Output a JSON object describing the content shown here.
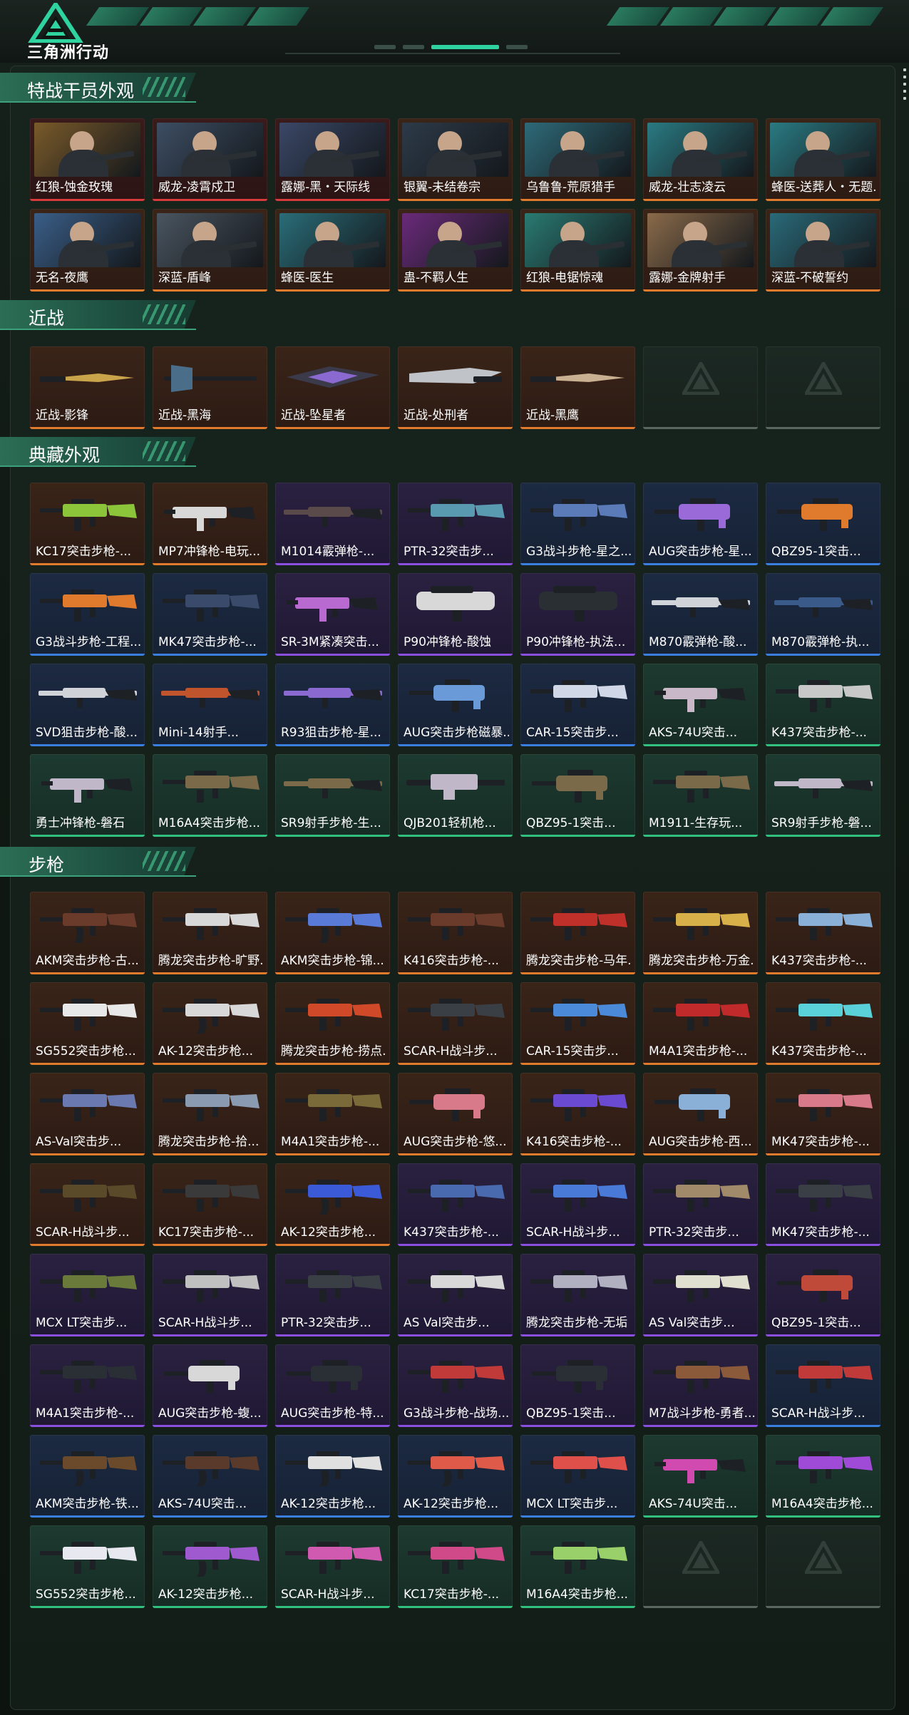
{
  "app": {
    "logo_text": "三角洲行动"
  },
  "sections": [
    {
      "title": "特战干员外观",
      "items": [
        {
          "label": "红狼-蚀金玫瑰",
          "rarity": "red",
          "kind": "agent",
          "tint": "#7a5a2a"
        },
        {
          "label": "威龙-凌霄戍卫",
          "rarity": "red",
          "kind": "agent",
          "tint": "#3d4e63"
        },
        {
          "label": "露娜-黑・天际线",
          "rarity": "red",
          "kind": "agent",
          "tint": "#3a4766"
        },
        {
          "label": "银翼-未结卷宗",
          "rarity": "orange",
          "kind": "agent",
          "tint": "#2d3a48"
        },
        {
          "label": "乌鲁鲁-荒原猎手",
          "rarity": "orange",
          "kind": "agent",
          "tint": "#2e6a78"
        },
        {
          "label": "威龙-壮志凌云",
          "rarity": "orange",
          "kind": "agent",
          "tint": "#2a7a82"
        },
        {
          "label": "蜂医-送葬人・无题...",
          "rarity": "orange",
          "kind": "agent",
          "tint": "#2a7a82"
        },
        {
          "label": "无名-夜鹰",
          "rarity": "orange",
          "kind": "agent",
          "tint": "#3a5e88"
        },
        {
          "label": "深蓝-盾峰",
          "rarity": "orange",
          "kind": "agent",
          "tint": "#4a5560"
        },
        {
          "label": "蜂医-医生",
          "rarity": "orange",
          "kind": "agent",
          "tint": "#2a6d78"
        },
        {
          "label": "蛊-不羁人生",
          "rarity": "orange",
          "kind": "agent",
          "tint": "#6a2a7a"
        },
        {
          "label": "红狼-电锯惊魂",
          "rarity": "orange",
          "kind": "agent",
          "tint": "#2a7a72"
        },
        {
          "label": "露娜-金牌射手",
          "rarity": "orange",
          "kind": "agent",
          "tint": "#8a6a4a"
        },
        {
          "label": "深蓝-不破誓约",
          "rarity": "orange",
          "kind": "agent",
          "tint": "#2a6a78"
        }
      ]
    },
    {
      "title": "近战",
      "items": [
        {
          "label": "近战-影锋",
          "rarity": "orange",
          "kind": "knife",
          "tint": "#c9a44a"
        },
        {
          "label": "近战-黑海",
          "rarity": "orange",
          "kind": "axe",
          "tint": "#4a6d8a"
        },
        {
          "label": "近战-坠星者",
          "rarity": "orange",
          "kind": "star",
          "tint": "#8a6ad0"
        },
        {
          "label": "近战-处刑者",
          "rarity": "orange",
          "kind": "blade",
          "tint": "#c0c4c8"
        },
        {
          "label": "近战-黑鹰",
          "rarity": "orange",
          "kind": "knife2",
          "tint": "#c8b090"
        },
        {
          "label": "",
          "rarity": "empty",
          "kind": "empty"
        },
        {
          "label": "",
          "rarity": "empty",
          "kind": "empty"
        }
      ]
    },
    {
      "title": "典藏外观",
      "items": [
        {
          "label": "KC17突击步枪-...",
          "rarity": "orange",
          "kind": "rifle",
          "tint": "#8cc43a"
        },
        {
          "label": "MP7冲锋枪-电玩...",
          "rarity": "orange",
          "kind": "smg",
          "tint": "#d8d8d8"
        },
        {
          "label": "M1014霰弹枪-...",
          "rarity": "purple",
          "kind": "shotgun",
          "tint": "#5a4a4a"
        },
        {
          "label": "PTR-32突击步...",
          "rarity": "purple",
          "kind": "rifle",
          "tint": "#5a9ab0"
        },
        {
          "label": "G3战斗步枪-星之...",
          "rarity": "blue",
          "kind": "rifle",
          "tint": "#5a7ab8"
        },
        {
          "label": "AUG突击步枪-星...",
          "rarity": "blue",
          "kind": "bullpup",
          "tint": "#9a6ad8"
        },
        {
          "label": "QBZ95-1突击...",
          "rarity": "blue",
          "kind": "bullpup",
          "tint": "#e07a2c"
        },
        {
          "label": "G3战斗步枪-工程...",
          "rarity": "blue",
          "kind": "rifle",
          "tint": "#e07a2c"
        },
        {
          "label": "MK47突击步枪-...",
          "rarity": "blue",
          "kind": "rifle",
          "tint": "#3a4a6a"
        },
        {
          "label": "SR-3M紧凑突击...",
          "rarity": "purple",
          "kind": "smg",
          "tint": "#b86ad0"
        },
        {
          "label": "P90冲锋枪-酸蚀",
          "rarity": "purple",
          "kind": "p90",
          "tint": "#d8d8d8"
        },
        {
          "label": "P90冲锋枪-执法...",
          "rarity": "purple",
          "kind": "p90",
          "tint": "#2a2f33"
        },
        {
          "label": "M870霰弹枪-酸...",
          "rarity": "blue",
          "kind": "shotgun",
          "tint": "#d0d4d8"
        },
        {
          "label": "M870霰弹枪-执...",
          "rarity": "blue",
          "kind": "shotgun",
          "tint": "#3a5a8a"
        },
        {
          "label": "SVD狙击步枪-酸...",
          "rarity": "blue",
          "kind": "sniper",
          "tint": "#d0d4d8"
        },
        {
          "label": "Mini-14射手...",
          "rarity": "blue",
          "kind": "sniper",
          "tint": "#c0542c"
        },
        {
          "label": "R93狙击步枪-星...",
          "rarity": "blue",
          "kind": "sniper",
          "tint": "#8a6ad0"
        },
        {
          "label": "AUG突击步枪磁暴...",
          "rarity": "blue",
          "kind": "bullpup",
          "tint": "#6a9ad8"
        },
        {
          "label": "CAR-15突击步...",
          "rarity": "blue",
          "kind": "rifle",
          "tint": "#d0d8e8"
        },
        {
          "label": "AKS-74U突击...",
          "rarity": "green",
          "kind": "smg",
          "tint": "#c8b8c8"
        },
        {
          "label": "K437突击步枪-...",
          "rarity": "green",
          "kind": "rifle",
          "tint": "#c8c8c8"
        },
        {
          "label": "勇士冲锋枪-磐石",
          "rarity": "green",
          "kind": "smg",
          "tint": "#c0b8c8"
        },
        {
          "label": "M16A4突击步枪...",
          "rarity": "green",
          "kind": "rifle",
          "tint": "#7a6a4a"
        },
        {
          "label": "SR9射手步枪-生...",
          "rarity": "green",
          "kind": "sniper",
          "tint": "#7a6a4a"
        },
        {
          "label": "QJB201轻机枪...",
          "rarity": "green",
          "kind": "lmg",
          "tint": "#c0b8c8"
        },
        {
          "label": "QBZ95-1突击...",
          "rarity": "green",
          "kind": "bullpup",
          "tint": "#7a6a4a"
        },
        {
          "label": "M1911-生存玩...",
          "rarity": "green",
          "kind": "rifle",
          "tint": "#7a6a4a"
        },
        {
          "label": "SR9射手步枪-磐...",
          "rarity": "green",
          "kind": "sniper",
          "tint": "#c0b8c8"
        }
      ]
    },
    {
      "title": "步枪",
      "items": [
        {
          "label": "AKM突击步枪-古...",
          "rarity": "orange",
          "kind": "ak",
          "tint": "#6a3a2a"
        },
        {
          "label": "腾龙突击步枪-旷野...",
          "rarity": "orange",
          "kind": "rifle",
          "tint": "#d8d8d8"
        },
        {
          "label": "AKM突击步枪-锦...",
          "rarity": "orange",
          "kind": "ak",
          "tint": "#5a7ad8"
        },
        {
          "label": "K416突击步枪-...",
          "rarity": "orange",
          "kind": "rifle",
          "tint": "#6a3a2a"
        },
        {
          "label": "腾龙突击步枪-马年...",
          "rarity": "orange",
          "kind": "rifle",
          "tint": "#c0302a"
        },
        {
          "label": "腾龙突击步枪-万金...",
          "rarity": "orange",
          "kind": "rifle",
          "tint": "#d8b04a"
        },
        {
          "label": "K437突击步枪-...",
          "rarity": "orange",
          "kind": "rifle",
          "tint": "#8ab0d8"
        },
        {
          "label": "SG552突击步枪...",
          "rarity": "orange",
          "kind": "rifle",
          "tint": "#e8e8e8"
        },
        {
          "label": "AK-12突击步枪...",
          "rarity": "orange",
          "kind": "ak",
          "tint": "#d8d8d8"
        },
        {
          "label": "腾龙突击步枪-捞点...",
          "rarity": "orange",
          "kind": "rifle",
          "tint": "#d04a2a"
        },
        {
          "label": "SCAR-H战斗步...",
          "rarity": "orange",
          "kind": "rifle",
          "tint": "#3a3f45"
        },
        {
          "label": "CAR-15突击步...",
          "rarity": "orange",
          "kind": "rifle",
          "tint": "#4a8ad8"
        },
        {
          "label": "M4A1突击步枪-...",
          "rarity": "orange",
          "kind": "rifle",
          "tint": "#c02a2a"
        },
        {
          "label": "K437突击步枪-...",
          "rarity": "orange",
          "kind": "rifle",
          "tint": "#5ad0d8"
        },
        {
          "label": "AS-Val突击步...",
          "rarity": "orange",
          "kind": "rifle",
          "tint": "#6a7ab0"
        },
        {
          "label": "腾龙突击步枪-拾...",
          "rarity": "orange",
          "kind": "rifle",
          "tint": "#8a9ab0"
        },
        {
          "label": "M4A1突击步枪-...",
          "rarity": "orange",
          "kind": "rifle",
          "tint": "#7a6a3a"
        },
        {
          "label": "AUG突击步枪-悠...",
          "rarity": "orange",
          "kind": "bullpup",
          "tint": "#d87a8a"
        },
        {
          "label": "K416突击步枪-...",
          "rarity": "orange",
          "kind": "rifle",
          "tint": "#6a4ad0"
        },
        {
          "label": "AUG突击步枪-西...",
          "rarity": "orange",
          "kind": "bullpup",
          "tint": "#8ab0d8"
        },
        {
          "label": "MK47突击步枪-...",
          "rarity": "orange",
          "kind": "rifle",
          "tint": "#d87a8a"
        },
        {
          "label": "SCAR-H战斗步...",
          "rarity": "orange",
          "kind": "rifle",
          "tint": "#5a4a2a"
        },
        {
          "label": "KC17突击步枪-...",
          "rarity": "orange",
          "kind": "rifle",
          "tint": "#3a3a3a"
        },
        {
          "label": "AK-12突击步枪...",
          "rarity": "orange",
          "kind": "ak",
          "tint": "#3a5ad8"
        },
        {
          "label": "K437突击步枪-...",
          "rarity": "purple",
          "kind": "rifle",
          "tint": "#4a6ab0"
        },
        {
          "label": "SCAR-H战斗步...",
          "rarity": "purple",
          "kind": "rifle",
          "tint": "#4a7ad8"
        },
        {
          "label": "PTR-32突击步...",
          "rarity": "purple",
          "kind": "rifle",
          "tint": "#a08a6a"
        },
        {
          "label": "MK47突击步枪-...",
          "rarity": "purple",
          "kind": "rifle",
          "tint": "#3a3f45"
        },
        {
          "label": "MCX LT突击步...",
          "rarity": "purple",
          "kind": "rifle",
          "tint": "#6a7a3a"
        },
        {
          "label": "SCAR-H战斗步...",
          "rarity": "purple",
          "kind": "rifle",
          "tint": "#c0c0c0"
        },
        {
          "label": "PTR-32突击步...",
          "rarity": "purple",
          "kind": "rifle",
          "tint": "#3a3f45"
        },
        {
          "label": "AS Val突击步...",
          "rarity": "purple",
          "kind": "rifle",
          "tint": "#d8d8d8"
        },
        {
          "label": "腾龙突击步枪-无垢",
          "rarity": "purple",
          "kind": "rifle",
          "tint": "#b0b0c0"
        },
        {
          "label": "AS Val突击步...",
          "rarity": "purple",
          "kind": "rifle",
          "tint": "#e0e0d0"
        },
        {
          "label": "QBZ95-1突击...",
          "rarity": "purple",
          "kind": "bullpup",
          "tint": "#c04a3a"
        },
        {
          "label": "M4A1突击步枪-...",
          "rarity": "purple",
          "kind": "rifle",
          "tint": "#2a2f35"
        },
        {
          "label": "AUG突击步枪-蝮...",
          "rarity": "purple",
          "kind": "bullpup",
          "tint": "#d8d8d8"
        },
        {
          "label": "AUG突击步枪-特...",
          "rarity": "purple",
          "kind": "bullpup",
          "tint": "#2a2f35"
        },
        {
          "label": "G3战斗步枪-战场...",
          "rarity": "purple",
          "kind": "rifle",
          "tint": "#c03a3a"
        },
        {
          "label": "QBZ95-1突击...",
          "rarity": "purple",
          "kind": "bullpup",
          "tint": "#2a2f35"
        },
        {
          "label": "M7战斗步枪-勇者...",
          "rarity": "purple",
          "kind": "rifle",
          "tint": "#8a5a3a"
        },
        {
          "label": "SCAR-H战斗步...",
          "rarity": "blue",
          "kind": "rifle",
          "tint": "#c03a3a"
        },
        {
          "label": "AKM突击步枪-铁...",
          "rarity": "blue",
          "kind": "ak",
          "tint": "#6a4a2a"
        },
        {
          "label": "AKS-74U突击...",
          "rarity": "blue",
          "kind": "ak",
          "tint": "#5a3a2a"
        },
        {
          "label": "AK-12突击步枪...",
          "rarity": "blue",
          "kind": "ak",
          "tint": "#e0e0e0"
        },
        {
          "label": "AK-12突击步枪...",
          "rarity": "blue",
          "kind": "ak",
          "tint": "#e05a4a"
        },
        {
          "label": "MCX LT突击步...",
          "rarity": "blue",
          "kind": "rifle",
          "tint": "#e0504a"
        },
        {
          "label": "AKS-74U突击...",
          "rarity": "green",
          "kind": "smg",
          "tint": "#d04ab0"
        },
        {
          "label": "M16A4突击步枪...",
          "rarity": "green",
          "kind": "rifle",
          "tint": "#a04ad8"
        },
        {
          "label": "SG552突击步枪...",
          "rarity": "green",
          "kind": "rifle",
          "tint": "#e8e8f0"
        },
        {
          "label": "AK-12突击步枪...",
          "rarity": "green",
          "kind": "ak",
          "tint": "#a05ad0"
        },
        {
          "label": "SCAR-H战斗步...",
          "rarity": "green",
          "kind": "rifle",
          "tint": "#d05ab0"
        },
        {
          "label": "KC17突击步枪-...",
          "rarity": "green",
          "kind": "rifle",
          "tint": "#d04a8a"
        },
        {
          "label": "M16A4突击步枪...",
          "rarity": "green",
          "kind": "rifle",
          "tint": "#9ad06a"
        },
        {
          "label": "",
          "rarity": "empty",
          "kind": "empty"
        },
        {
          "label": "",
          "rarity": "empty",
          "kind": "empty"
        }
      ]
    }
  ]
}
